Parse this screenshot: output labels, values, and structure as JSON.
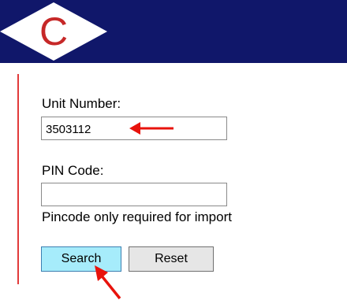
{
  "header": {
    "logo_icon": "c-diamond-logo-icon",
    "logo_letter": "C",
    "colors": {
      "bar": "#10176a",
      "logo_letter": "#c62828"
    }
  },
  "form": {
    "unit_number_label": "Unit Number:",
    "unit_number_value": "3503112",
    "pin_code_label": "PIN Code:",
    "pin_code_value": "",
    "pin_hint": "Pincode only required for import",
    "search_label": "Search",
    "reset_label": "Reset"
  },
  "annotations": {
    "arrow_icon": "red-arrow-icon",
    "color": "#e8130c"
  }
}
